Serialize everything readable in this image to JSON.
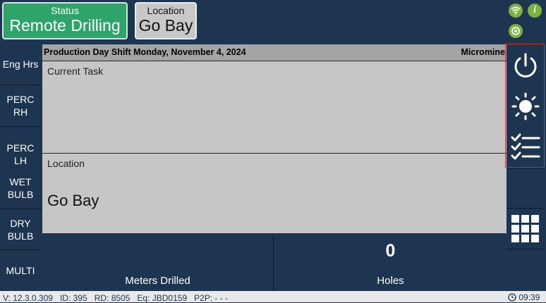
{
  "top": {
    "status_caption": "Status",
    "status_value": "Remote Drilling",
    "location_caption": "Location",
    "location_value": "Go Bay"
  },
  "sidebar": {
    "items": [
      {
        "label": "Eng Hrs"
      },
      {
        "label": "PERC RH"
      },
      {
        "label": "PERC LH"
      },
      {
        "label": "WET BULB"
      },
      {
        "label": "DRY BULB"
      },
      {
        "label": "MULTI"
      }
    ]
  },
  "header": {
    "shift_text": "Production Day Shift Monday, November 4, 2024",
    "brand": "Micromine"
  },
  "current_task": {
    "caption": "Current Task"
  },
  "location_panel": {
    "caption": "Location",
    "value": "Go Bay"
  },
  "stats": {
    "meters_label": "Meters Drilled",
    "holes_label": "Holes",
    "holes_value": "0"
  },
  "rail": {
    "icons": [
      "power-icon",
      "brightness-icon",
      "checklist-icon",
      "blank",
      "grid-icon"
    ]
  },
  "footer": {
    "version": "V: 12.3.0.309",
    "id": "ID: 395",
    "rd": "RD: 8505",
    "eq": "Eq: JBD0159",
    "p2p": "P2P: - - -",
    "time": "09:39"
  },
  "colors": {
    "background": "#1d3550",
    "status_green": "#2ea36a",
    "panel_gray": "#c6c6c6",
    "indicator_green": "#7cb23f",
    "selection_red": "#c0392b"
  }
}
